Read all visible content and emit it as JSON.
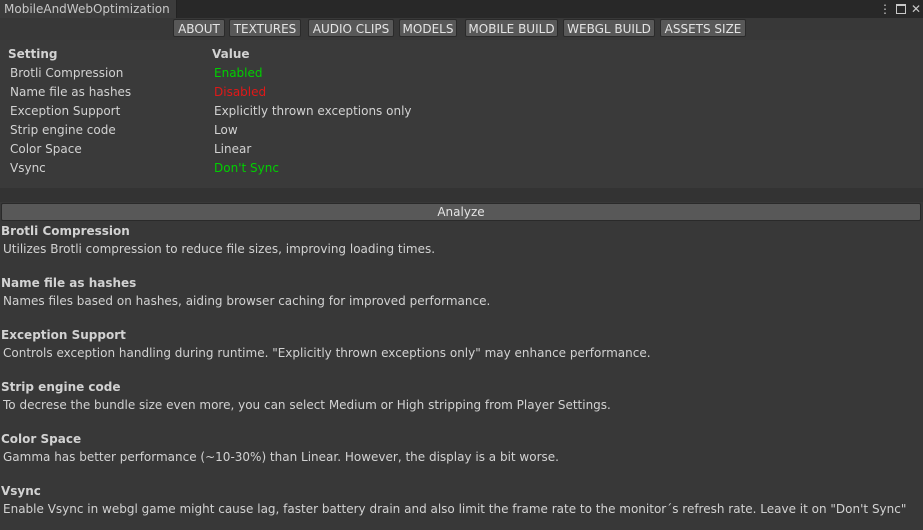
{
  "window": {
    "tab_title": "MobileAndWebOptimization",
    "menu_icon": "kebab-menu-icon",
    "maximize_icon": "maximize-icon",
    "close_icon": "close-icon"
  },
  "toolbar": {
    "tabs": [
      "ABOUT",
      "TEXTURES",
      "AUDIO CLIPS",
      "MODELS",
      "MOBILE BUILD",
      "WEBGL BUILD",
      "ASSETS SIZE"
    ]
  },
  "settings": {
    "header_setting": "Setting",
    "header_value": "Value",
    "rows": [
      {
        "label": "Brotli Compression",
        "value": "Enabled",
        "status": "good"
      },
      {
        "label": "Name file as hashes",
        "value": "Disabled",
        "status": "bad"
      },
      {
        "label": "Exception Support",
        "value": "Explicitly thrown exceptions only",
        "status": "neutral"
      },
      {
        "label": "Strip engine code",
        "value": "Low",
        "status": "neutral"
      },
      {
        "label": "Color Space",
        "value": "Linear",
        "status": "neutral"
      },
      {
        "label": "Vsync",
        "value": "Don't Sync",
        "status": "good"
      }
    ]
  },
  "colors": {
    "good": "#00d000",
    "bad": "#e01818",
    "neutral": "#d2d2d2"
  },
  "analyze_label": "Analyze",
  "descriptions": [
    {
      "title": "Brotli Compression",
      "text": "Utilizes Brotli compression to reduce file sizes, improving loading times."
    },
    {
      "title": "Name file as hashes",
      "text": "Names files based on hashes, aiding browser caching for improved performance."
    },
    {
      "title": "Exception Support",
      "text": "Controls exception handling during runtime. \"Explicitly thrown exceptions only\" may enhance performance."
    },
    {
      "title": "Strip engine code",
      "text": "To decrese the bundle size even more, you can select Medium or High stripping from Player Settings."
    },
    {
      "title": "Color Space",
      "text": "Gamma has better performance (~10-30%) than Linear. However, the display is a bit worse."
    },
    {
      "title": "Vsync",
      "text": "Enable Vsync in webgl game might cause lag, faster battery drain and also limit the frame rate to the monitor´s refresh rate. Leave it on \"Don't Sync\""
    }
  ]
}
